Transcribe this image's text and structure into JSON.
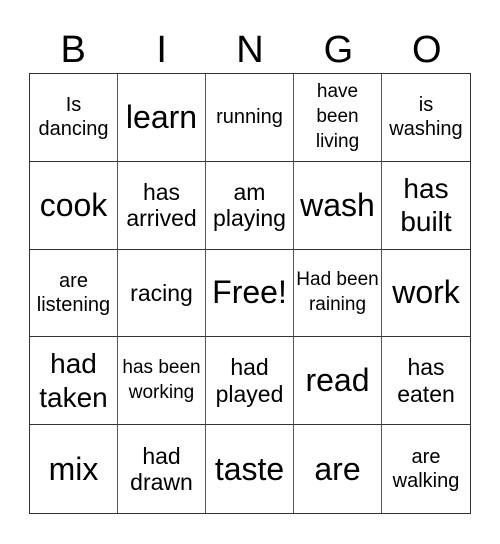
{
  "header": [
    "B",
    "I",
    "N",
    "G",
    "O"
  ],
  "cells": [
    [
      "Is dancing",
      "learn",
      "running",
      "have been living",
      "is washing"
    ],
    [
      "cook",
      "has arrived",
      "am playing",
      "wash",
      "has built"
    ],
    [
      "are listening",
      "racing",
      "Free!",
      "Had been raining",
      "work"
    ],
    [
      "had taken",
      "has been working",
      "had played",
      "read",
      "has eaten"
    ],
    [
      "mix",
      "had drawn",
      "taste",
      "are",
      "are walking"
    ]
  ]
}
